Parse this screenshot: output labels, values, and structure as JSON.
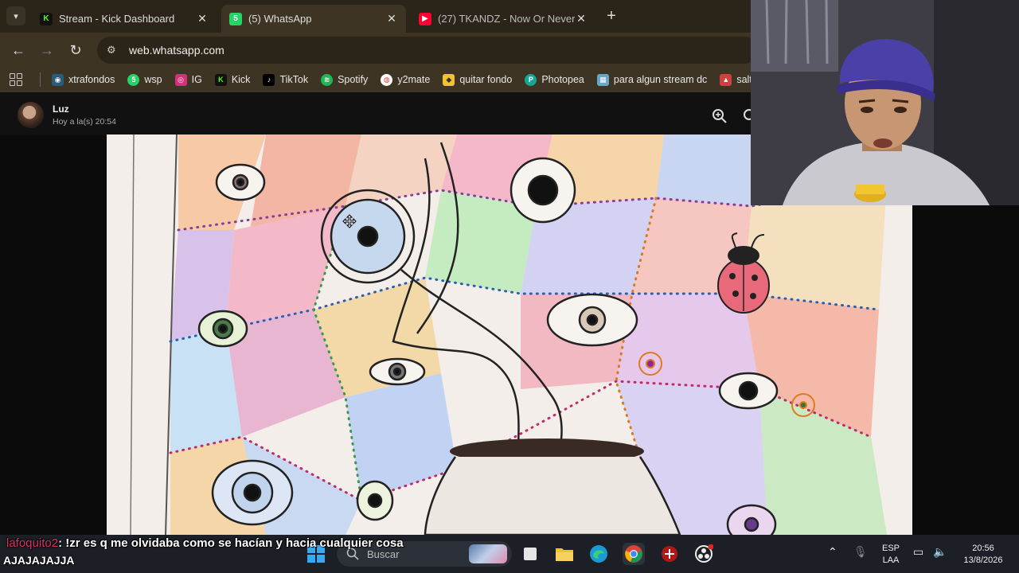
{
  "browser": {
    "tabs": [
      {
        "title": "Stream - Kick Dashboard",
        "favicon": "kick-icon",
        "color": "#53fc18",
        "active": false
      },
      {
        "title": "(5) WhatsApp",
        "favicon": "whatsapp-icon",
        "color": "#25d366",
        "active": true
      },
      {
        "title": "(27) TKANDZ - Now Or Never (",
        "favicon": "youtube-icon",
        "color": "#ff0033",
        "active": false
      }
    ],
    "url": "web.whatsapp.com",
    "bookmarks": [
      {
        "label": "xtrafondos",
        "icon": "eye-icon",
        "color": "#5aa0d8"
      },
      {
        "label": "wsp",
        "icon": "whatsapp-icon",
        "color": "#25d366"
      },
      {
        "label": "IG",
        "icon": "instagram-icon",
        "color": "#d6307a"
      },
      {
        "label": "Kick",
        "icon": "kick-icon",
        "color": "#53fc18"
      },
      {
        "label": "TikTok",
        "icon": "tiktok-icon",
        "color": "#000000"
      },
      {
        "label": "Spotify",
        "icon": "spotify-icon",
        "color": "#1db954"
      },
      {
        "label": "y2mate",
        "icon": "y2mate-icon",
        "color": "#e04040"
      },
      {
        "label": "quitar fondo",
        "icon": "removebg-icon",
        "color": "#f2c230"
      },
      {
        "label": "Photopea",
        "icon": "photopea-icon",
        "color": "#18a497"
      },
      {
        "label": "para algun stream dc",
        "icon": "image-icon",
        "color": "#6aa6c8"
      },
      {
        "label": "salto",
        "icon": "tree-icon",
        "color": "#d04040"
      }
    ]
  },
  "viewer": {
    "sender": "Luz",
    "time": "Hoy a la(s) 20:54"
  },
  "chat": {
    "username": "lafoquito2",
    "message": ": !zr es q me olvidaba como se hacían y hacia cualquier cosa",
    "partial_line": "AJAJAJAJJA"
  },
  "taskbar": {
    "search_placeholder": "Buscar",
    "language": "ESP",
    "layout": "LAA",
    "time": "20:56",
    "date": "13/8/2026"
  }
}
